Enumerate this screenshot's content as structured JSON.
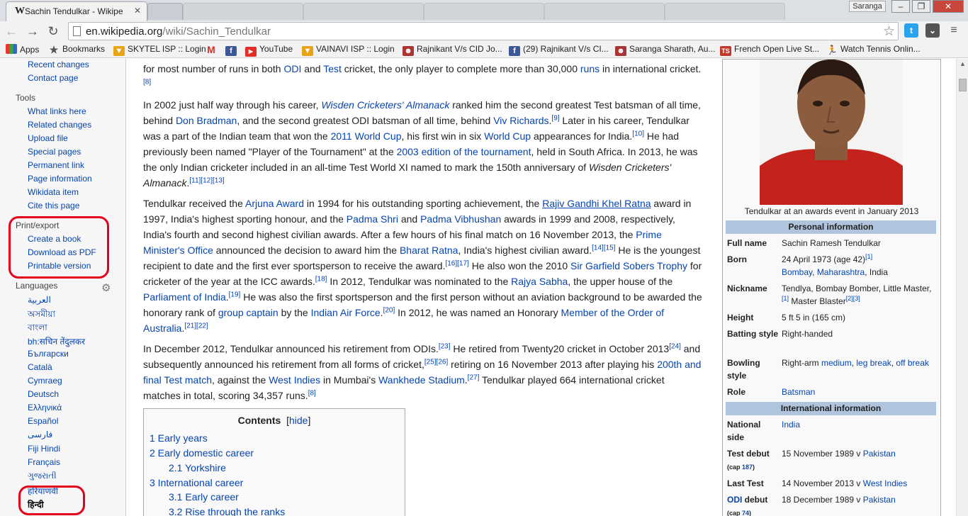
{
  "browser": {
    "active_tab_title": "Sachin Tendulkar - Wikipe",
    "url_host": "en.wikipedia.org",
    "url_path": "/wiki/Sachin_Tendulkar",
    "user_name": "Saranga"
  },
  "bookmarks": [
    {
      "label": "Apps",
      "icon": "apps-grid-icon"
    },
    {
      "label": "Bookmarks",
      "icon": "star-icon"
    },
    {
      "label": "SKYTEL ISP :: Login",
      "icon": "shield-icon"
    },
    {
      "label": "",
      "icon": "gmail-icon"
    },
    {
      "label": "",
      "icon": "facebook-icon"
    },
    {
      "label": "YouTube",
      "icon": "youtube-icon"
    },
    {
      "label": "VAINAVI ISP :: Login",
      "icon": "shield-icon"
    },
    {
      "label": "Rajnikant V/s CID Jo...",
      "icon": "figure-icon"
    },
    {
      "label": "(29) Rajnikant V/s CI...",
      "icon": "facebook-icon"
    },
    {
      "label": "Saranga Sharath, Au...",
      "icon": "figure-icon"
    },
    {
      "label": "French Open Live St...",
      "icon": "ts-icon"
    },
    {
      "label": "Watch Tennis Onlin...",
      "icon": "runner-icon"
    }
  ],
  "sidebar": {
    "nav_links": [
      "Recent changes",
      "Contact page"
    ],
    "tools_heading": "Tools",
    "tools": [
      "What links here",
      "Related changes",
      "Upload file",
      "Special pages",
      "Permanent link",
      "Page information",
      "Wikidata item",
      "Cite this page"
    ],
    "print_heading": "Print/export",
    "print": [
      "Create a book",
      "Download as PDF",
      "Printable version"
    ],
    "languages_heading": "Languages",
    "languages": [
      "العربية",
      "অসমীয়া",
      "বাংলা",
      "bh:सचिन तेंदुलकर",
      "Български",
      "Català",
      "Cymraeg",
      "Deutsch",
      "Ελληνικά",
      "Español",
      "فارسی",
      "Fiji Hindi",
      "Français",
      "ગુજરાતી",
      "हरियाणवी",
      "हिन्दी"
    ]
  },
  "article": {
    "p1": {
      "t1": "for most number of runs in both ",
      "l1": "ODI",
      "t2": " and ",
      "l2": "Test",
      "t3": " cricket, the only player to complete more than 30,000 ",
      "l3": "runs",
      "t4": " in international cricket.",
      "r1": "[8]"
    },
    "p2": {
      "t1": "In 2002 just half way through his career, ",
      "l1": "Wisden Cricketers' Almanack",
      "t2": " ranked him the second greatest Test batsman of all time, behind ",
      "l2": "Don Bradman",
      "t3": ", and the second greatest ODI batsman of all time, behind ",
      "l3": "Viv Richards",
      "r1": "[9]",
      "t4": " Later in his career, Tendulkar was a part of the Indian team that won the ",
      "l4": "2011 World Cup",
      "t5": ", his first win in six ",
      "l5": "World Cup",
      "t6": " appearances for India.",
      "r2": "[10]",
      "t7": " He had previously been named \"Player of the Tournament\" at the ",
      "l6": "2003 edition of the tournament",
      "t8": ", held in South Africa. In 2013, he was the only Indian cricketer included in an all-time Test World XI named to mark the 150th anniversary of ",
      "i1": "Wisden Cricketers' Almanack",
      "t9": ".",
      "r3": "[11]",
      "r4": "[12]",
      "r5": "[13]"
    },
    "p3": {
      "t1": "Tendulkar received the ",
      "l1": "Arjuna Award",
      "t2": " in 1994 for his outstanding sporting achievement, the ",
      "l2": "Rajiv Gandhi Khel Ratna",
      "t3": " award in 1997, India's highest sporting honour, and the ",
      "l3": "Padma Shri",
      "t4": " and ",
      "l4": "Padma Vibhushan",
      "t5": " awards in 1999 and 2008, respectively, India's fourth and second highest civilian awards. After a few hours of his final match on 16 November 2013, the ",
      "l5": "Prime Minister's Office",
      "t6": " announced the decision to award him the ",
      "l6": "Bharat Ratna",
      "t7": ", India's highest civilian award.",
      "r1": "[14]",
      "r2": "[15]",
      "t8": " He is the youngest recipient to date and the first ever sportsperson to receive the award.",
      "r3": "[16]",
      "r4": "[17]",
      "t9": " He also won the 2010 ",
      "l7": "Sir Garfield Sobers Trophy",
      "t10": " for cricketer of the year at the ICC awards.",
      "r5": "[18]",
      "t11": " In 2012, Tendulkar was nominated to the ",
      "l8": "Rajya Sabha",
      "t12": ", the upper house of the ",
      "l9": "Parliament of India",
      "t13": ".",
      "r6": "[19]",
      "t14": " He was also the first sportsperson and the first person without an aviation background to be awarded the honorary rank of ",
      "l10": "group captain",
      "t15": " by the ",
      "l11": "Indian Air Force",
      "t16": ".",
      "r7": "[20]",
      "t17": " In 2012, he was named an Honorary ",
      "l12": "Member of the Order of Australia",
      "t18": ".",
      "r8": "[21]",
      "r9": "[22]"
    },
    "p4": {
      "t1": "In December 2012, Tendulkar announced his retirement from ODIs.",
      "r1": "[23]",
      "t2": " He retired from Twenty20 cricket in October 2013",
      "r2": "[24]",
      "t3": " and subsequently announced his retirement from all forms of cricket,",
      "r3": "[25]",
      "r4": "[26]",
      "t4": " retiring on 16 November 2013 after playing his ",
      "l1": "200th and final Test match",
      "t5": ", against the ",
      "l2": "West Indies",
      "t6": " in Mumbai's ",
      "l3": "Wankhede Stadium",
      "t7": ".",
      "r5": "[27]",
      "t8": " Tendulkar played 664 international cricket matches in total, scoring 34,357 runs.",
      "r6": "[8]"
    }
  },
  "toc": {
    "title": "Contents",
    "hide_label": "hide",
    "items": [
      "1 Early years",
      "2 Early domestic career",
      "2.1 Yorkshire",
      "3 International career",
      "3.1 Early career",
      "3.2 Rise through the ranks"
    ]
  },
  "infobox": {
    "caption": "Tendulkar at an awards event in January 2013",
    "personal_heading": "Personal information",
    "full_name_label": "Full name",
    "full_name": "Sachin Ramesh Tendulkar",
    "born_label": "Born",
    "born_date": "24 April 1973 (age 42)",
    "born_ref": "[1]",
    "born_place1": "Bombay",
    "born_place2": "Maharashtra",
    "born_place3": "India",
    "nickname_label": "Nickname",
    "nickname": "Tendlya, Bombay Bomber, Little Master,",
    "nickname_ref1": "[1]",
    "nickname2": " Master Blaster",
    "nickname_ref2": "[2][3]",
    "height_label": "Height",
    "height": "5 ft 5 in (165 cm)",
    "batting_label": "Batting style",
    "batting": "Right-handed",
    "bowling_label": "Bowling style",
    "bowling_pre": "Right-arm ",
    "bowling_l1": "medium",
    "bowling_l2": "leg break",
    "bowling_l3": "off break",
    "role_label": "Role",
    "role": "Batsman",
    "intl_heading": "International information",
    "national_label": "National side",
    "national": "India",
    "test_debut_label": "Test debut",
    "test_debut": "15 November 1989 v ",
    "test_debut_opp": "Pakistan",
    "test_cap_pre": "(cap ",
    "test_cap": "187",
    "test_cap_post": ")",
    "last_test_label": "Last Test",
    "last_test": "14 November 2013 v ",
    "last_test_opp": "West Indies",
    "odi_label_link": "ODI",
    "odi_label_rest": " debut",
    "odi_debut": "18 December 1989 v ",
    "odi_debut_opp": "Pakistan",
    "odi_cap_pre": "(cap ",
    "odi_cap": "74",
    "odi_cap_post": ")"
  }
}
